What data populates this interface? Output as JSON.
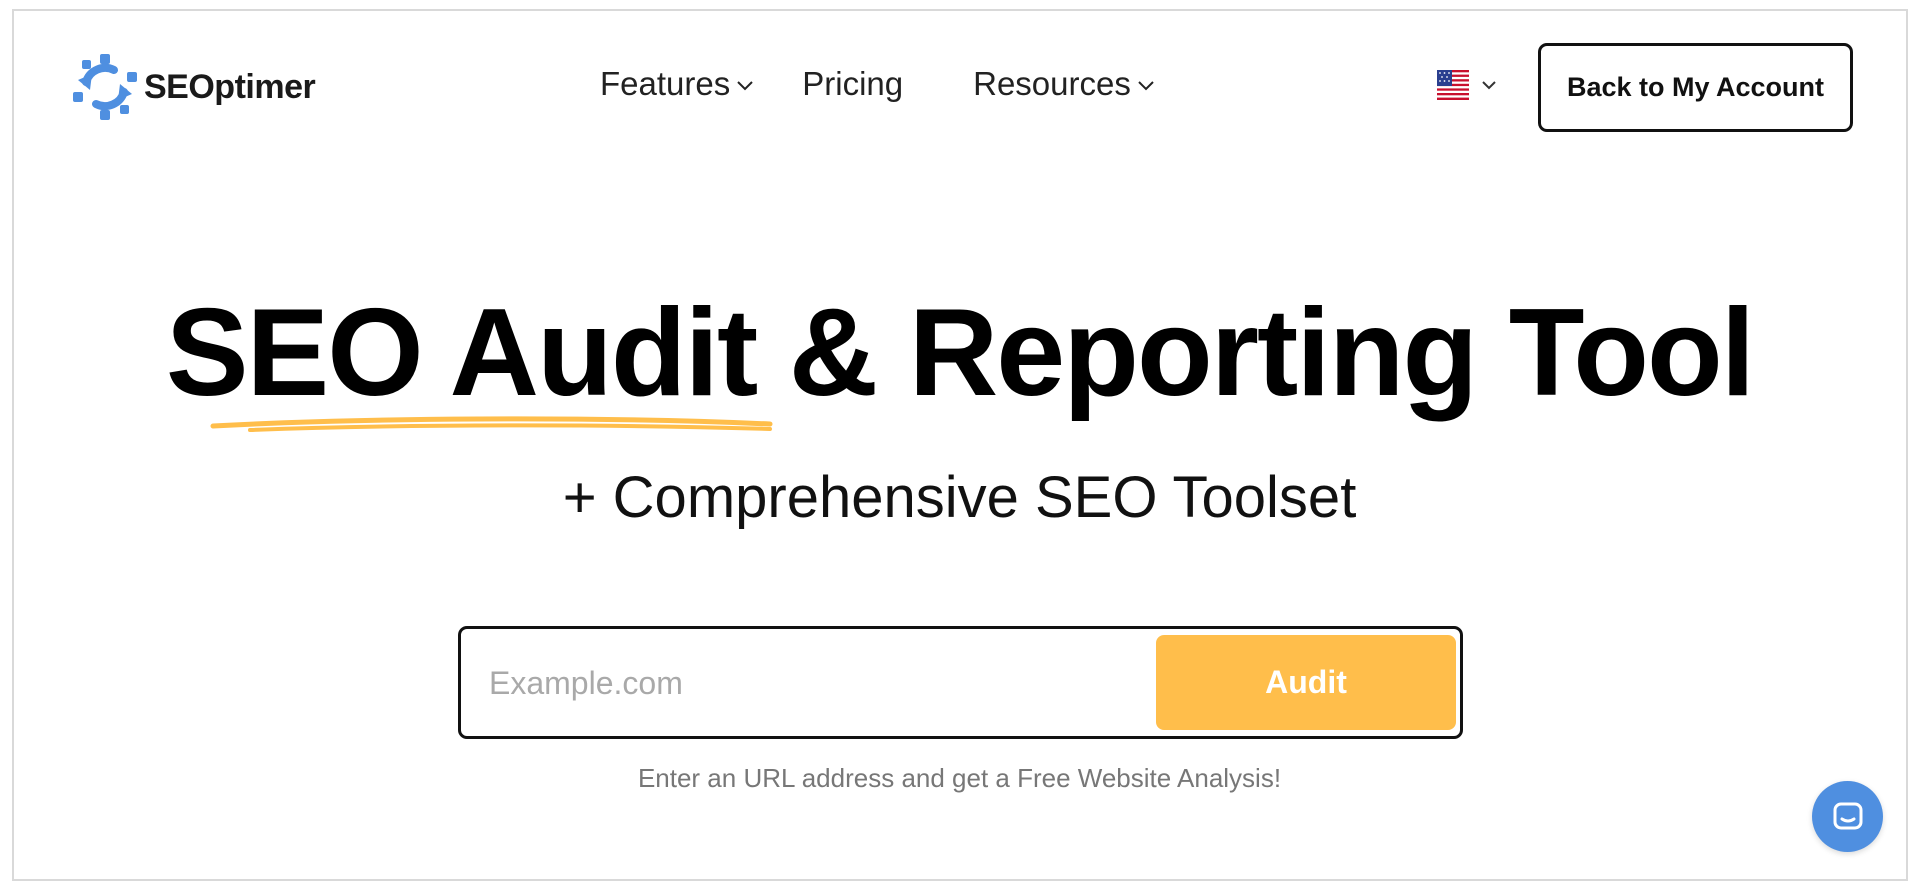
{
  "brand": {
    "name": "SEOptimer",
    "logo_icon": "gear-arrows-icon",
    "logo_color": "#4f8fe0"
  },
  "nav": {
    "features": "Features",
    "pricing": "Pricing",
    "resources": "Resources",
    "dropdown_icon": "chevron-down-icon"
  },
  "language": {
    "flag_icon": "us-flag-icon"
  },
  "header": {
    "account_button": "Back to My Account"
  },
  "hero": {
    "title": "SEO Audit & Reporting Tool",
    "subtitle": "+ Comprehensive SEO Toolset",
    "underline_color": "#ffbe4b"
  },
  "audit_form": {
    "placeholder": "Example.com",
    "value": "",
    "button_label": "Audit",
    "button_color": "#ffbe4b"
  },
  "hint": "Enter an URL address and get a Free Website Analysis!",
  "chat": {
    "icon": "chat-icon",
    "color": "#4f8fe0"
  }
}
